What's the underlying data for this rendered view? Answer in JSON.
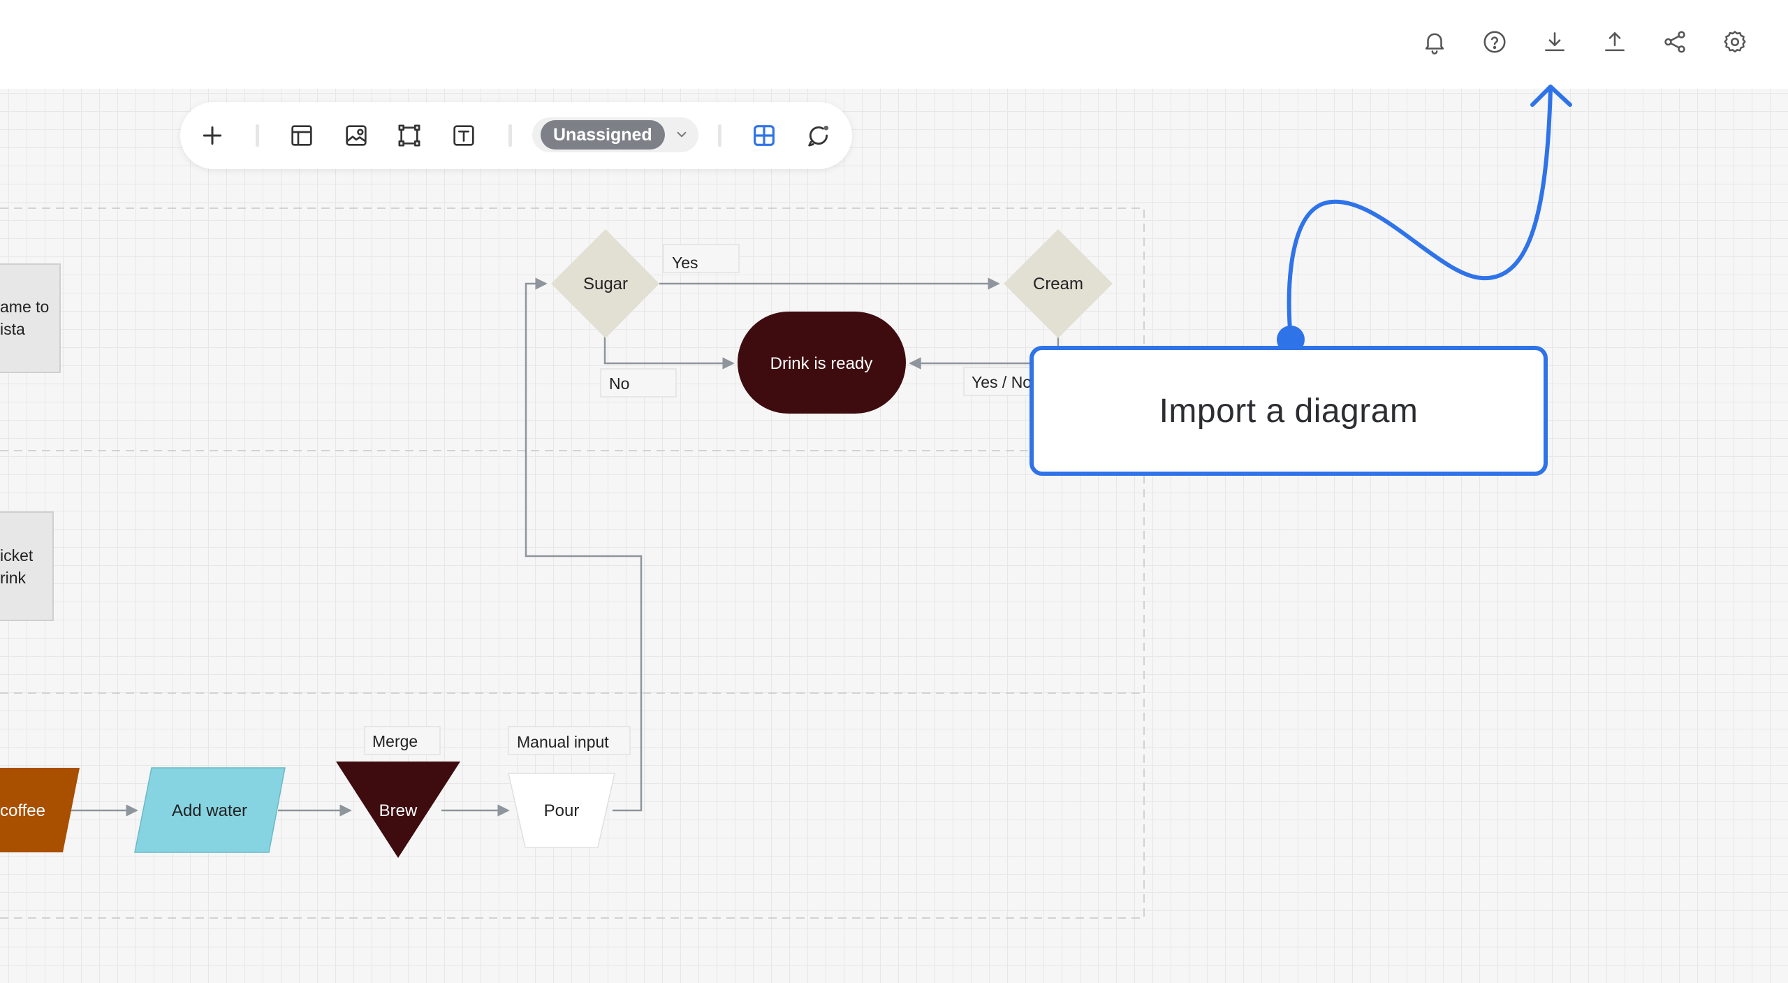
{
  "header": {
    "icons": [
      "bell-icon",
      "help-icon",
      "download-icon",
      "upload-icon",
      "share-icon",
      "gear-icon"
    ]
  },
  "toolbar": {
    "status_label": "Unassigned",
    "icons": [
      "plus-icon",
      "layout-icon",
      "image-icon",
      "frame-icon",
      "text-icon",
      "chevron-down-icon",
      "grid-icon",
      "comment-icon"
    ]
  },
  "diagram": {
    "sidebar_labels": {
      "partial_1": [
        "ame to",
        "ista"
      ],
      "partial_2": [
        "icket",
        "rink"
      ]
    },
    "nodes": {
      "sugar": "Sugar",
      "cream": "Cream",
      "drink_ready": "Drink is ready",
      "coffee": "coffee",
      "add_water": "Add water",
      "brew": "Brew",
      "pour": "Pour"
    },
    "labels": {
      "yes": "Yes",
      "no": "No",
      "yes_no": "Yes / No",
      "merge": "Merge",
      "manual_input": "Manual input"
    }
  },
  "callout": {
    "text": "Import a diagram"
  },
  "colors": {
    "accent_blue": "#2f73e8",
    "drink_node": "#3e0c0f",
    "brew_node": "#3e0c0f",
    "coffee_node": "#a94f00",
    "water_node": "#86d4e2",
    "decision_node": "#e2dfd3"
  }
}
